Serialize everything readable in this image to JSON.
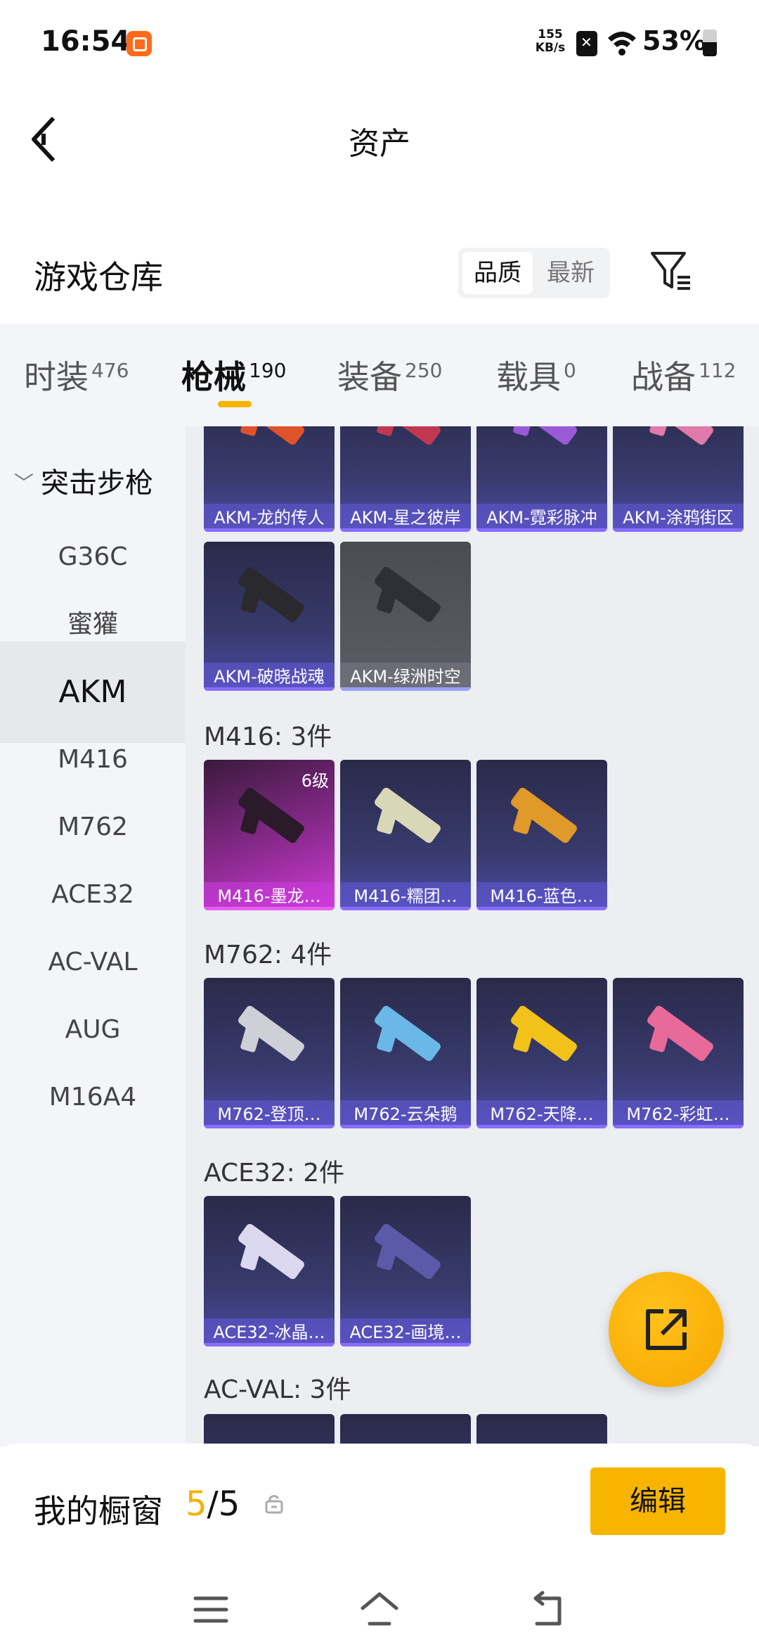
{
  "status_bar": {
    "time": "16:54",
    "net_speed_value": "155",
    "net_speed_unit": "KB/s",
    "battery": "53%",
    "battery_level": 0.53
  },
  "header": {
    "title": "资产"
  },
  "warehouse": {
    "title": "游戏仓库",
    "sort_options": [
      "品质",
      "最新"
    ],
    "sort_selected": "品质"
  },
  "tabs": [
    {
      "label": "时装",
      "count": "476"
    },
    {
      "label": "枪械",
      "count": "190"
    },
    {
      "label": "装备",
      "count": "250"
    },
    {
      "label": "载具",
      "count": "0"
    },
    {
      "label": "战备",
      "count": "112"
    }
  ],
  "active_tab": "枪械",
  "sidebar": {
    "group": "突击步枪",
    "items": [
      "G36C",
      "蜜獾",
      "AKM",
      "M416",
      "M762",
      "ACE32",
      "AC-VAL",
      "AUG",
      "M16A4"
    ],
    "active": "AKM"
  },
  "sections": [
    {
      "title": "",
      "items": [
        {
          "name": "AKM-龙的传人"
        },
        {
          "name": "AKM-星之彼岸"
        },
        {
          "name": "AKM-霓彩脉冲"
        },
        {
          "name": "AKM-涂鸦街区"
        },
        {
          "name": "AKM-破晓战魂"
        },
        {
          "name": "AKM-绿洲时空"
        }
      ]
    },
    {
      "title": "M416: 3件",
      "items": [
        {
          "name": "M416-墨龙…",
          "grade": "6级"
        },
        {
          "name": "M416-糯团…"
        },
        {
          "name": "M416-蓝色…"
        }
      ]
    },
    {
      "title": "M762: 4件",
      "items": [
        {
          "name": "M762-登顶…"
        },
        {
          "name": "M762-云朵鹅"
        },
        {
          "name": "M762-天降…"
        },
        {
          "name": "M762-彩虹…"
        }
      ]
    },
    {
      "title": "ACE32: 2件",
      "items": [
        {
          "name": "ACE32-冰晶…"
        },
        {
          "name": "ACE32-画境…"
        }
      ]
    },
    {
      "title": "AC-VAL: 3件",
      "items": []
    }
  ],
  "bottom": {
    "showcase_label": "我的橱窗",
    "showcase_current": "5",
    "showcase_total": "/5",
    "edit_label": "编辑"
  },
  "colors": {
    "accent": "#f7b500",
    "card_purple": "#3a3a72",
    "card_gray": "#55575e",
    "card_pink": "#b030c0"
  }
}
